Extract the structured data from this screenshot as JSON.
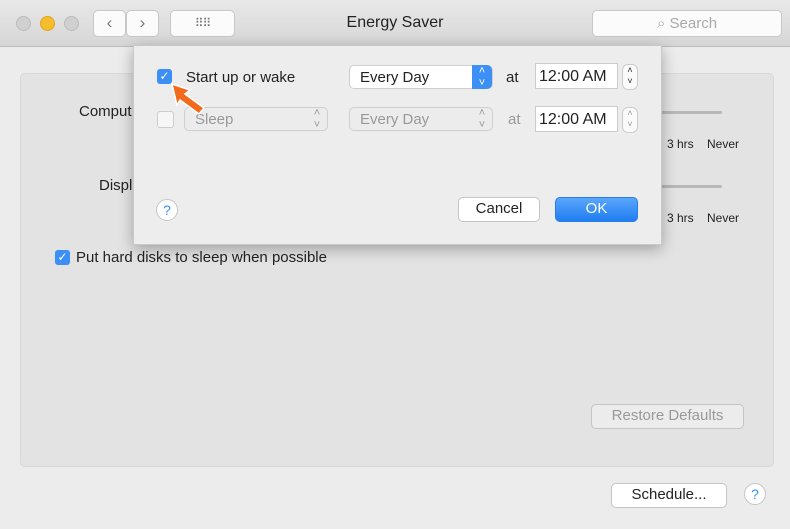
{
  "window": {
    "title": "Energy Saver",
    "search_placeholder": "Search"
  },
  "settings": {
    "computer_label": "Comput",
    "display_label": "Displ",
    "slider_ticks": [
      "3 hrs",
      "Never"
    ],
    "hard_disks_label": "Put hard disks to sleep when possible",
    "hard_disks_checked": true,
    "restore_defaults": "Restore Defaults",
    "schedule": "Schedule...",
    "help": "?"
  },
  "sheet": {
    "row1": {
      "checked": true,
      "label": "Start up or wake",
      "frequency": "Every Day",
      "at": "at",
      "time": "12:00 AM"
    },
    "row2": {
      "checked": false,
      "action": "Sleep",
      "frequency": "Every Day",
      "at": "at",
      "time": "12:00 AM"
    },
    "help": "?",
    "cancel": "Cancel",
    "ok": "OK"
  },
  "colors": {
    "accent": "#3b8ff5",
    "pointer": "#f26b1d"
  }
}
